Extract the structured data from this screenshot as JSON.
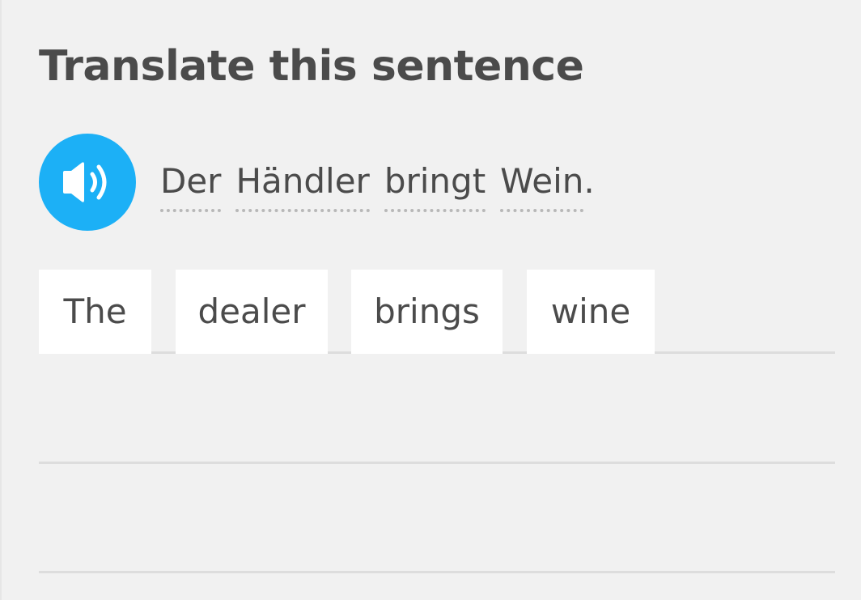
{
  "prompt": {
    "title": "Translate this sentence"
  },
  "audio": {
    "icon": "speaker-icon",
    "color": "#1cb0f6"
  },
  "source_sentence": {
    "words": [
      "Der",
      "Händler",
      "bringt",
      "Wein"
    ],
    "punctuation": "."
  },
  "answer": {
    "tiles": [
      "The",
      "dealer",
      "brings",
      "wine"
    ]
  },
  "colors": {
    "background": "#f1f1f1",
    "text": "#4b4b4b",
    "tile": "#ffffff",
    "line": "#dddddd",
    "accent": "#1cb0f6"
  }
}
